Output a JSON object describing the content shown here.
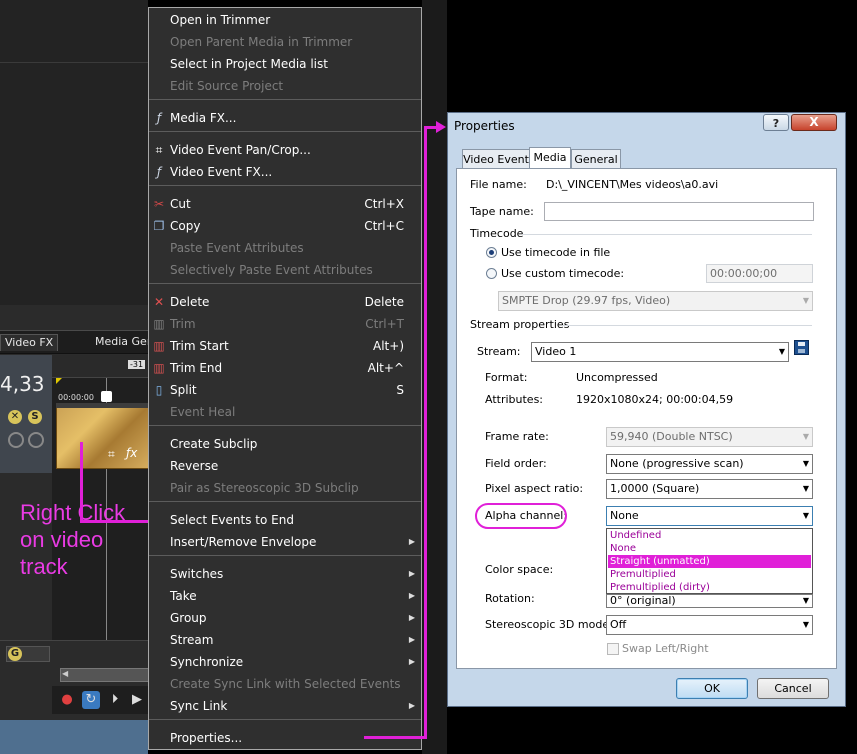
{
  "editor": {
    "tabs": [
      "Video FX",
      "Media Gen"
    ],
    "time_display": "4,33",
    "ruler_marker": "-31",
    "clip_time": "00:00:00",
    "annotation": [
      "Right Click",
      "on video",
      "track"
    ],
    "icons": [
      "mute-icon",
      "solo-icon",
      "fx-icon",
      "crop-icon",
      "record-icon",
      "loop-icon",
      "play-icon"
    ]
  },
  "context_menu": {
    "items": [
      {
        "label": "Open in Trimmer",
        "shortcut": "",
        "disabled": false,
        "icon": "",
        "submenu": false
      },
      {
        "label": "Open Parent Media in Trimmer",
        "shortcut": "",
        "disabled": true,
        "icon": "",
        "submenu": false
      },
      {
        "label": "Select in Project Media list",
        "shortcut": "",
        "disabled": false,
        "icon": "",
        "submenu": false
      },
      {
        "label": "Edit Source Project",
        "shortcut": "",
        "disabled": true,
        "icon": "",
        "submenu": false
      },
      {
        "label": "Media FX...",
        "shortcut": "",
        "disabled": false,
        "icon": "fx-icon",
        "submenu": false
      },
      {
        "label": "Video Event Pan/Crop...",
        "shortcut": "",
        "disabled": false,
        "icon": "crop-icon",
        "submenu": false
      },
      {
        "label": "Video Event FX...",
        "shortcut": "",
        "disabled": false,
        "icon": "fx-icon",
        "submenu": false
      },
      {
        "label": "Cut",
        "shortcut": "Ctrl+X",
        "disabled": false,
        "icon": "scissors-icon",
        "submenu": false
      },
      {
        "label": "Copy",
        "shortcut": "Ctrl+C",
        "disabled": false,
        "icon": "copy-icon",
        "submenu": false
      },
      {
        "label": "Paste Event Attributes",
        "shortcut": "",
        "disabled": true,
        "icon": "",
        "submenu": false
      },
      {
        "label": "Selectively Paste Event Attributes",
        "shortcut": "",
        "disabled": true,
        "icon": "",
        "submenu": false
      },
      {
        "label": "Delete",
        "shortcut": "Delete",
        "disabled": false,
        "icon": "delete-icon",
        "submenu": false
      },
      {
        "label": "Trim",
        "shortcut": "Ctrl+T",
        "disabled": true,
        "icon": "trim-icon",
        "submenu": false
      },
      {
        "label": "Trim Start",
        "shortcut": "Alt+)",
        "disabled": false,
        "icon": "trim-start-icon",
        "submenu": false
      },
      {
        "label": "Trim End",
        "shortcut": "Alt+^",
        "disabled": false,
        "icon": "trim-end-icon",
        "submenu": false
      },
      {
        "label": "Split",
        "shortcut": "S",
        "disabled": false,
        "icon": "split-icon",
        "submenu": false
      },
      {
        "label": "Event Heal",
        "shortcut": "",
        "disabled": true,
        "icon": "",
        "submenu": false
      },
      {
        "label": "Create Subclip",
        "shortcut": "",
        "disabled": false,
        "icon": "",
        "submenu": false
      },
      {
        "label": "Reverse",
        "shortcut": "",
        "disabled": false,
        "icon": "",
        "submenu": false
      },
      {
        "label": "Pair as Stereoscopic 3D Subclip",
        "shortcut": "",
        "disabled": true,
        "icon": "",
        "submenu": false
      },
      {
        "label": "Select Events to End",
        "shortcut": "",
        "disabled": false,
        "icon": "",
        "submenu": false
      },
      {
        "label": "Insert/Remove Envelope",
        "shortcut": "",
        "disabled": false,
        "icon": "",
        "submenu": true
      },
      {
        "label": "Switches",
        "shortcut": "",
        "disabled": false,
        "icon": "",
        "submenu": true
      },
      {
        "label": "Take",
        "shortcut": "",
        "disabled": false,
        "icon": "",
        "submenu": true
      },
      {
        "label": "Group",
        "shortcut": "",
        "disabled": false,
        "icon": "",
        "submenu": true
      },
      {
        "label": "Stream",
        "shortcut": "",
        "disabled": false,
        "icon": "",
        "submenu": true
      },
      {
        "label": "Synchronize",
        "shortcut": "",
        "disabled": false,
        "icon": "",
        "submenu": true
      },
      {
        "label": "Create Sync Link with Selected Events",
        "shortcut": "",
        "disabled": true,
        "icon": "",
        "submenu": false
      },
      {
        "label": "Sync Link",
        "shortcut": "",
        "disabled": false,
        "icon": "",
        "submenu": true
      },
      {
        "label": "Properties...",
        "shortcut": "",
        "disabled": false,
        "icon": "",
        "submenu": false
      }
    ]
  },
  "dialog": {
    "title": "Properties",
    "help_label": "?",
    "close_label": "X",
    "tabs": [
      "Video Event",
      "Media",
      "General"
    ],
    "active_tab": "Media",
    "file_name_label": "File name:",
    "file_name_value": "D:\\_VINCENT\\Mes videos\\a0.avi",
    "tape_name_label": "Tape name:",
    "tape_name_value": "",
    "timecode_label": "Timecode",
    "use_timecode_label": "Use timecode in file",
    "use_custom_label": "Use custom timecode:",
    "custom_timecode_value": "00:00:00;00",
    "timecode_format": "SMPTE Drop (29.97 fps, Video)",
    "stream_props_label": "Stream properties",
    "stream_label": "Stream:",
    "stream_value": "Video 1",
    "format_label": "Format:",
    "format_value": "Uncompressed",
    "attributes_label": "Attributes:",
    "attributes_value": "1920x1080x24; 00:00:04,59",
    "frame_rate_label": "Frame rate:",
    "frame_rate_value": "59,940 (Double NTSC)",
    "field_order_label": "Field order:",
    "field_order_value": "None (progressive scan)",
    "par_label": "Pixel aspect ratio:",
    "par_value": "1,0000 (Square)",
    "alpha_label": "Alpha channel:",
    "alpha_value": "None",
    "alpha_options": [
      "Undefined",
      "None",
      "Straight (unmatted)",
      "Premultiplied",
      "Premultiplied (dirty)"
    ],
    "alpha_highlighted": "Straight (unmatted)",
    "color_space_label": "Color space:",
    "rotation_label": "Rotation:",
    "rotation_value": "0° (original)",
    "stereo_label": "Stereoscopic 3D mode:",
    "stereo_value": "Off",
    "swap_label": "Swap Left/Right",
    "ok_label": "OK",
    "cancel_label": "Cancel"
  },
  "colors": {
    "menu_bg": "#2f2f2f",
    "dialog_bg": "#c5d7ea",
    "annotation": "#e020d8",
    "dropdown_highlight": "#e020d8"
  }
}
